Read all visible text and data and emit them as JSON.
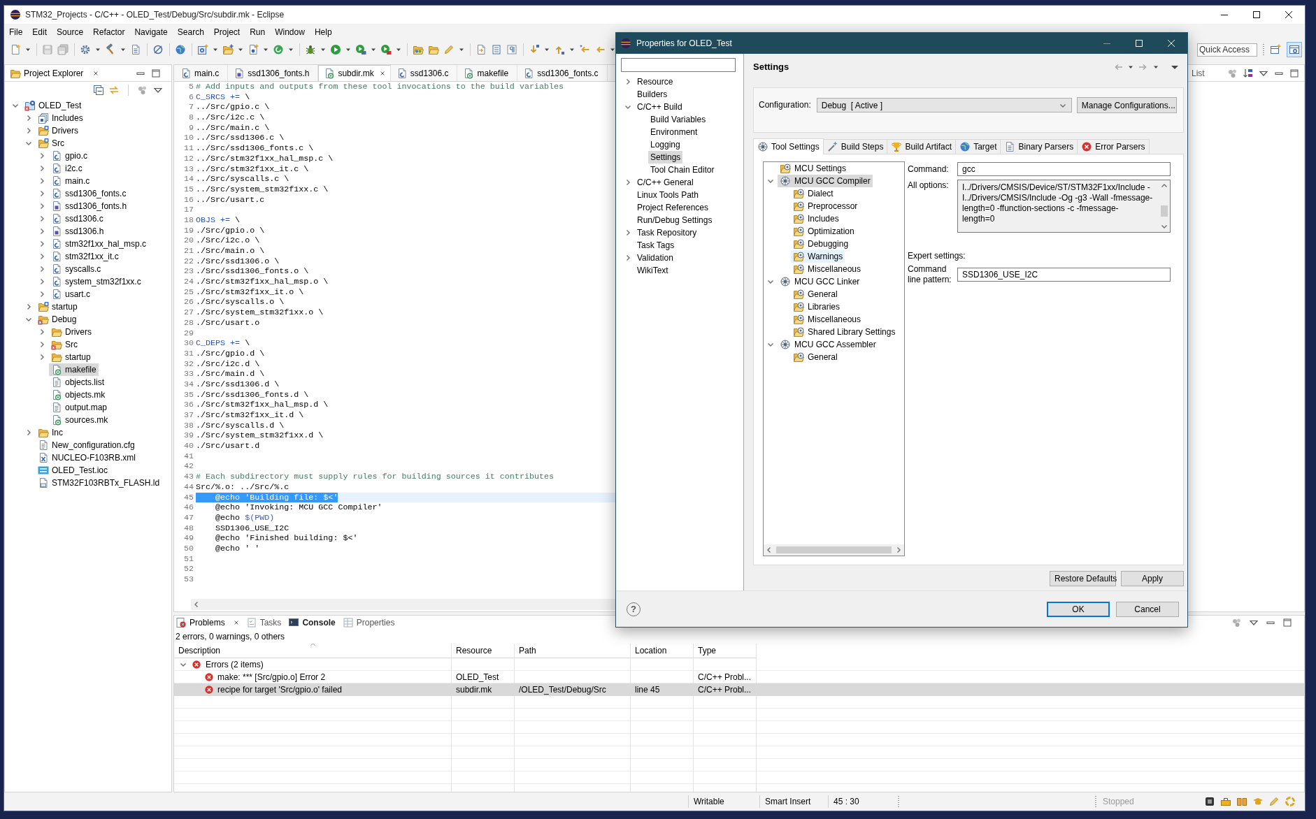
{
  "window": {
    "title": "STM32_Projects - C/C++ - OLED_Test/Debug/Src/subdir.mk - Eclipse"
  },
  "menu": [
    "File",
    "Edit",
    "Source",
    "Refactor",
    "Navigate",
    "Search",
    "Project",
    "Run",
    "Window",
    "Help"
  ],
  "toolbar": {
    "quick_access": {
      "placeholder": "Quick Access"
    }
  },
  "project_explorer": {
    "title": "Project Explorer",
    "tree": [
      {
        "label": "OLED_Test",
        "kind": "project",
        "expanded": true,
        "selected": false,
        "error": true,
        "children": [
          {
            "label": "Includes",
            "kind": "includes",
            "expanded": false,
            "selected": false,
            "error": false
          },
          {
            "label": "Drivers",
            "kind": "source-folder",
            "expanded": false,
            "selected": false,
            "error": false
          },
          {
            "label": "Src",
            "kind": "source-folder",
            "expanded": true,
            "selected": false,
            "error": false,
            "children": [
              {
                "label": "gpio.c",
                "kind": "c-file",
                "expanded": false,
                "selected": false,
                "error": false
              },
              {
                "label": "i2c.c",
                "kind": "c-file",
                "expanded": false,
                "selected": false,
                "error": false
              },
              {
                "label": "main.c",
                "kind": "c-file",
                "expanded": false,
                "selected": false,
                "error": false
              },
              {
                "label": "ssd1306_fonts.c",
                "kind": "c-file",
                "expanded": false,
                "selected": false,
                "error": false
              },
              {
                "label": "ssd1306_fonts.h",
                "kind": "h-file",
                "expanded": false,
                "selected": false,
                "error": false
              },
              {
                "label": "ssd1306.c",
                "kind": "c-file",
                "expanded": false,
                "selected": false,
                "error": false
              },
              {
                "label": "ssd1306.h",
                "kind": "h-file",
                "expanded": false,
                "selected": false,
                "error": false
              },
              {
                "label": "stm32f1xx_hal_msp.c",
                "kind": "c-file",
                "expanded": false,
                "selected": false,
                "error": false
              },
              {
                "label": "stm32f1xx_it.c",
                "kind": "c-file",
                "expanded": false,
                "selected": false,
                "error": false
              },
              {
                "label": "syscalls.c",
                "kind": "c-file",
                "expanded": false,
                "selected": false,
                "error": false
              },
              {
                "label": "system_stm32f1xx.c",
                "kind": "c-file",
                "expanded": false,
                "selected": false,
                "error": false
              },
              {
                "label": "usart.c",
                "kind": "c-file",
                "expanded": false,
                "selected": false,
                "error": false
              }
            ]
          },
          {
            "label": "startup",
            "kind": "source-folder",
            "expanded": false,
            "selected": false,
            "error": false
          },
          {
            "label": "Debug",
            "kind": "folder",
            "expanded": true,
            "selected": false,
            "error": true,
            "children": [
              {
                "label": "Drivers",
                "kind": "folder",
                "expanded": false,
                "selected": false,
                "error": false
              },
              {
                "label": "Src",
                "kind": "folder",
                "expanded": false,
                "selected": false,
                "error": true
              },
              {
                "label": "startup",
                "kind": "folder",
                "expanded": false,
                "selected": false,
                "error": false
              },
              {
                "label": "makefile",
                "kind": "makefile",
                "selected": true,
                "error": false
              },
              {
                "label": "objects.list",
                "kind": "text-file",
                "selected": false,
                "error": false
              },
              {
                "label": "objects.mk",
                "kind": "makefile",
                "selected": false,
                "error": false
              },
              {
                "label": "output.map",
                "kind": "text-file",
                "selected": false,
                "error": false
              },
              {
                "label": "sources.mk",
                "kind": "makefile",
                "selected": false,
                "error": false
              }
            ]
          },
          {
            "label": "Inc",
            "kind": "folder",
            "expanded": false,
            "selected": false,
            "error": false
          },
          {
            "label": "New_configuration.cfg",
            "kind": "text-file",
            "selected": false,
            "error": false
          },
          {
            "label": "NUCLEO-F103RB.xml",
            "kind": "xml-file",
            "selected": false,
            "error": false
          },
          {
            "label": "OLED_Test.ioc",
            "kind": "ioc-file",
            "selected": false,
            "error": false
          },
          {
            "label": "STM32F103RBTx_FLASH.ld",
            "kind": "linker-file",
            "selected": false,
            "error": false
          }
        ]
      }
    ]
  },
  "editor": {
    "tabs": [
      {
        "label": "main.c",
        "kind": "c-file",
        "selected": false
      },
      {
        "label": "ssd1306_fonts.h",
        "kind": "h-file",
        "selected": false
      },
      {
        "label": "subdir.mk",
        "kind": "makefile",
        "selected": true
      },
      {
        "label": "ssd1306.c",
        "kind": "c-file",
        "selected": false
      },
      {
        "label": "makefile",
        "kind": "makefile",
        "selected": false
      },
      {
        "label": "ssd1306_fonts.c",
        "kind": "c-file",
        "selected": false
      }
    ],
    "lines": [
      {
        "number": "5",
        "current": false,
        "segments": [
          {
            "kind": "comment",
            "text": "# Add inputs and outputs from these tool invocations to the build variables"
          }
        ]
      },
      {
        "number": "6",
        "current": false,
        "segments": [
          {
            "kind": "macro",
            "text": "C_SRCS +="
          },
          {
            "kind": "text",
            "text": " \\"
          }
        ]
      },
      {
        "number": "7",
        "current": false,
        "segments": [
          {
            "kind": "text",
            "text": "../Src/gpio.c \\"
          }
        ]
      },
      {
        "number": "8",
        "current": false,
        "segments": [
          {
            "kind": "text",
            "text": "../Src/i2c.c \\"
          }
        ]
      },
      {
        "number": "9",
        "current": false,
        "segments": [
          {
            "kind": "text",
            "text": "../Src/main.c \\"
          }
        ]
      },
      {
        "number": "10",
        "current": false,
        "segments": [
          {
            "kind": "text",
            "text": "../Src/ssd1306.c \\"
          }
        ]
      },
      {
        "number": "11",
        "current": false,
        "segments": [
          {
            "kind": "text",
            "text": "../Src/ssd1306_fonts.c \\"
          }
        ]
      },
      {
        "number": "12",
        "current": false,
        "segments": [
          {
            "kind": "text",
            "text": "../Src/stm32f1xx_hal_msp.c \\"
          }
        ]
      },
      {
        "number": "13",
        "current": false,
        "segments": [
          {
            "kind": "text",
            "text": "../Src/stm32f1xx_it.c \\"
          }
        ]
      },
      {
        "number": "14",
        "current": false,
        "segments": [
          {
            "kind": "text",
            "text": "../Src/syscalls.c \\"
          }
        ]
      },
      {
        "number": "15",
        "current": false,
        "segments": [
          {
            "kind": "text",
            "text": "../Src/system_stm32f1xx.c \\"
          }
        ]
      },
      {
        "number": "16",
        "current": false,
        "segments": [
          {
            "kind": "text",
            "text": "../Src/usart.c"
          }
        ]
      },
      {
        "number": "17",
        "current": false
      },
      {
        "number": "18",
        "current": false,
        "segments": [
          {
            "kind": "macro",
            "text": "OBJS +="
          },
          {
            "kind": "text",
            "text": " \\"
          }
        ]
      },
      {
        "number": "19",
        "current": false,
        "segments": [
          {
            "kind": "text",
            "text": "./Src/gpio.o \\"
          }
        ]
      },
      {
        "number": "20",
        "current": false,
        "segments": [
          {
            "kind": "text",
            "text": "./Src/i2c.o \\"
          }
        ]
      },
      {
        "number": "21",
        "current": false,
        "segments": [
          {
            "kind": "text",
            "text": "./Src/main.o \\"
          }
        ]
      },
      {
        "number": "22",
        "current": false,
        "segments": [
          {
            "kind": "text",
            "text": "./Src/ssd1306.o \\"
          }
        ]
      },
      {
        "number": "23",
        "current": false,
        "segments": [
          {
            "kind": "text",
            "text": "./Src/ssd1306_fonts.o \\"
          }
        ]
      },
      {
        "number": "24",
        "current": false,
        "segments": [
          {
            "kind": "text",
            "text": "./Src/stm32f1xx_hal_msp.o \\"
          }
        ]
      },
      {
        "number": "25",
        "current": false,
        "segments": [
          {
            "kind": "text",
            "text": "./Src/stm32f1xx_it.o \\"
          }
        ]
      },
      {
        "number": "26",
        "current": false,
        "segments": [
          {
            "kind": "text",
            "text": "./Src/syscalls.o \\"
          }
        ]
      },
      {
        "number": "27",
        "current": false,
        "segments": [
          {
            "kind": "text",
            "text": "./Src/system_stm32f1xx.o \\"
          }
        ]
      },
      {
        "number": "28",
        "current": false,
        "segments": [
          {
            "kind": "text",
            "text": "./Src/usart.o"
          }
        ]
      },
      {
        "number": "29",
        "current": false
      },
      {
        "number": "30",
        "current": false,
        "segments": [
          {
            "kind": "macro",
            "text": "C_DEPS +="
          },
          {
            "kind": "text",
            "text": " \\"
          }
        ]
      },
      {
        "number": "31",
        "current": false,
        "segments": [
          {
            "kind": "text",
            "text": "./Src/gpio.d \\"
          }
        ]
      },
      {
        "number": "32",
        "current": false,
        "segments": [
          {
            "kind": "text",
            "text": "./Src/i2c.d \\"
          }
        ]
      },
      {
        "number": "33",
        "current": false,
        "segments": [
          {
            "kind": "text",
            "text": "./Src/main.d \\"
          }
        ]
      },
      {
        "number": "34",
        "current": false,
        "segments": [
          {
            "kind": "text",
            "text": "./Src/ssd1306.d \\"
          }
        ]
      },
      {
        "number": "35",
        "current": false,
        "segments": [
          {
            "kind": "text",
            "text": "./Src/ssd1306_fonts.d \\"
          }
        ]
      },
      {
        "number": "36",
        "current": false,
        "segments": [
          {
            "kind": "text",
            "text": "./Src/stm32f1xx_hal_msp.d \\"
          }
        ]
      },
      {
        "number": "37",
        "current": false,
        "segments": [
          {
            "kind": "text",
            "text": "./Src/stm32f1xx_it.d \\"
          }
        ]
      },
      {
        "number": "38",
        "current": false,
        "segments": [
          {
            "kind": "text",
            "text": "./Src/syscalls.d \\"
          }
        ]
      },
      {
        "number": "39",
        "current": false,
        "segments": [
          {
            "kind": "text",
            "text": "./Src/system_stm32f1xx.d \\"
          }
        ]
      },
      {
        "number": "40",
        "current": false,
        "segments": [
          {
            "kind": "text",
            "text": "./Src/usart.d"
          }
        ]
      },
      {
        "number": "41",
        "current": false
      },
      {
        "number": "42",
        "current": false
      },
      {
        "number": "43",
        "current": false,
        "segments": [
          {
            "kind": "comment",
            "text": "# Each subdirectory must supply rules for building sources it contributes"
          }
        ]
      },
      {
        "number": "44",
        "current": false,
        "segments": [
          {
            "kind": "text",
            "text": "Src/%.o: ../Src/%.c"
          }
        ]
      },
      {
        "number": "45",
        "current": true,
        "segments": [
          {
            "kind": "selection",
            "text": "    @echo 'Building file: $<'"
          }
        ]
      },
      {
        "number": "46",
        "current": false,
        "segments": [
          {
            "kind": "text",
            "text": "    @echo 'Invoking: MCU GCC Compiler'"
          }
        ]
      },
      {
        "number": "47",
        "current": false,
        "segments": [
          {
            "kind": "text",
            "text": "    @echo "
          },
          {
            "kind": "variable",
            "text": "$(PWD)"
          }
        ]
      },
      {
        "number": "48",
        "current": false,
        "segments": [
          {
            "kind": "text",
            "text": "    SSD1306_USE_I2C"
          }
        ]
      },
      {
        "number": "49",
        "current": false,
        "segments": [
          {
            "kind": "text",
            "text": "    @echo 'Finished building: $<'"
          }
        ]
      },
      {
        "number": "50",
        "current": false,
        "segments": [
          {
            "kind": "text",
            "text": "    @echo ' '"
          }
        ]
      },
      {
        "number": "51",
        "current": false
      },
      {
        "number": "52",
        "current": false
      },
      {
        "number": "53",
        "current": false
      }
    ]
  },
  "side_view": {
    "tab": "List"
  },
  "problems_view": {
    "tabs": [
      {
        "label": "Problems",
        "kind": "problems",
        "selected": true,
        "highlighted": false
      },
      {
        "label": "Tasks",
        "kind": "tasks",
        "selected": false,
        "highlighted": false
      },
      {
        "label": "Console",
        "kind": "console",
        "selected": false,
        "highlighted": true
      },
      {
        "label": "Properties",
        "kind": "properties",
        "selected": false,
        "highlighted": false
      }
    ],
    "summary": "2 errors, 0 warnings, 0 others",
    "columns": [
      {
        "label": "Description",
        "sorted": true
      },
      {
        "label": "Resource",
        "sorted": false
      },
      {
        "label": "Path",
        "sorted": false
      },
      {
        "label": "Location",
        "sorted": false
      },
      {
        "label": "Type",
        "sorted": false
      }
    ],
    "rows": [
      {
        "kind": "error",
        "description": "Errors (2 items)",
        "expanded": true,
        "selected": false,
        "children": [
          {
            "kind": "error",
            "description": "make: *** [Src/gpio.o] Error 2",
            "resource": "OLED_Test",
            "type": "C/C++ Probl...",
            "selected": false
          },
          {
            "kind": "error",
            "description": "recipe for target 'Src/gpio.o' failed",
            "resource": "subdir.mk",
            "path": "/OLED_Test/Debug/Src",
            "location": "line 45",
            "type": "C/C++ Probl...",
            "selected": true
          }
        ]
      }
    ]
  },
  "status_bar": {
    "mode": "Writable",
    "insert_mode": "Smart Insert",
    "position": "45 : 30",
    "progress": "Stopped"
  },
  "dialog": {
    "title": "Properties for OLED_Test",
    "nav_tree": [
      {
        "label": "Resource",
        "expanded": false,
        "selected": false
      },
      {
        "label": "Builders",
        "selected": false
      },
      {
        "label": "C/C++ Build",
        "expanded": true,
        "selected": false,
        "children": [
          {
            "label": "Build Variables",
            "selected": false
          },
          {
            "label": "Environment",
            "selected": false
          },
          {
            "label": "Logging",
            "selected": false
          },
          {
            "label": "Settings",
            "selected": true
          },
          {
            "label": "Tool Chain Editor",
            "selected": false
          }
        ]
      },
      {
        "label": "C/C++ General",
        "expanded": false,
        "selected": false
      },
      {
        "label": "Linux Tools Path",
        "selected": false
      },
      {
        "label": "Project References",
        "selected": false
      },
      {
        "label": "Run/Debug Settings",
        "selected": false
      },
      {
        "label": "Task Repository",
        "expanded": false,
        "selected": false
      },
      {
        "label": "Task Tags",
        "selected": false
      },
      {
        "label": "Validation",
        "expanded": false,
        "selected": false
      },
      {
        "label": "WikiText",
        "selected": false
      }
    ],
    "page_title": "Settings",
    "configuration": {
      "label": "Configuration:",
      "value": "Debug  [ Active ]",
      "button": "Manage Configurations..."
    },
    "tabs": [
      {
        "label": "Tool Settings",
        "kind": "tool-settings",
        "selected": true
      },
      {
        "label": "Build Steps",
        "kind": "build-steps",
        "selected": false
      },
      {
        "label": "Build Artifact",
        "kind": "build-artifact",
        "selected": false
      },
      {
        "label": "Target",
        "kind": "target",
        "selected": false
      },
      {
        "label": "Binary Parsers",
        "kind": "binary-parsers",
        "selected": false
      },
      {
        "label": "Error Parsers",
        "kind": "error-parsers",
        "selected": false
      }
    ],
    "tool_tree": [
      {
        "label": "MCU Settings",
        "kind": "category",
        "selected": false,
        "hovered": false
      },
      {
        "label": "MCU GCC Compiler",
        "kind": "tool",
        "expanded": true,
        "selected": true,
        "hovered": false,
        "children": [
          {
            "label": "Dialect",
            "kind": "category",
            "selected": false,
            "hovered": false
          },
          {
            "label": "Preprocessor",
            "kind": "category",
            "selected": false,
            "hovered": false
          },
          {
            "label": "Includes",
            "kind": "category",
            "selected": false,
            "hovered": false
          },
          {
            "label": "Optimization",
            "kind": "category",
            "selected": false,
            "hovered": false
          },
          {
            "label": "Debugging",
            "kind": "category",
            "selected": false,
            "hovered": false
          },
          {
            "label": "Warnings",
            "kind": "category",
            "selected": false,
            "hovered": true
          },
          {
            "label": "Miscellaneous",
            "kind": "category",
            "selected": false,
            "hovered": false
          }
        ]
      },
      {
        "label": "MCU GCC Linker",
        "kind": "tool",
        "expanded": true,
        "selected": false,
        "hovered": false,
        "children": [
          {
            "label": "General",
            "kind": "category",
            "selected": false,
            "hovered": false
          },
          {
            "label": "Libraries",
            "kind": "category",
            "selected": false,
            "hovered": false
          },
          {
            "label": "Miscellaneous",
            "kind": "category",
            "selected": false,
            "hovered": false
          },
          {
            "label": "Shared Library Settings",
            "kind": "category",
            "selected": false,
            "hovered": false
          }
        ]
      },
      {
        "label": "MCU GCC Assembler",
        "kind": "tool",
        "expanded": true,
        "selected": false,
        "hovered": false,
        "children": [
          {
            "label": "General",
            "kind": "category",
            "selected": false,
            "hovered": false
          }
        ]
      }
    ],
    "command": {
      "label": "Command:",
      "value": "gcc"
    },
    "all_options": {
      "label": "All options:",
      "lines": [
        "I../Drivers/CMSIS/Device/ST/STM32F1xx/Include -",
        "I../Drivers/CMSIS/Include -Og -g3 -Wall -fmessage-",
        "length=0 -ffunction-sections -c -fmessage-",
        "length=0"
      ]
    },
    "expert_settings": {
      "heading": "Expert settings:",
      "label": "Command line pattern:",
      "value": "SSD1306_USE_I2C"
    },
    "page_buttons": [
      "Restore Defaults",
      "Apply"
    ],
    "help": "?",
    "buttons": [
      {
        "label": "OK",
        "default": true
      },
      {
        "label": "Cancel",
        "default": false
      }
    ]
  }
}
